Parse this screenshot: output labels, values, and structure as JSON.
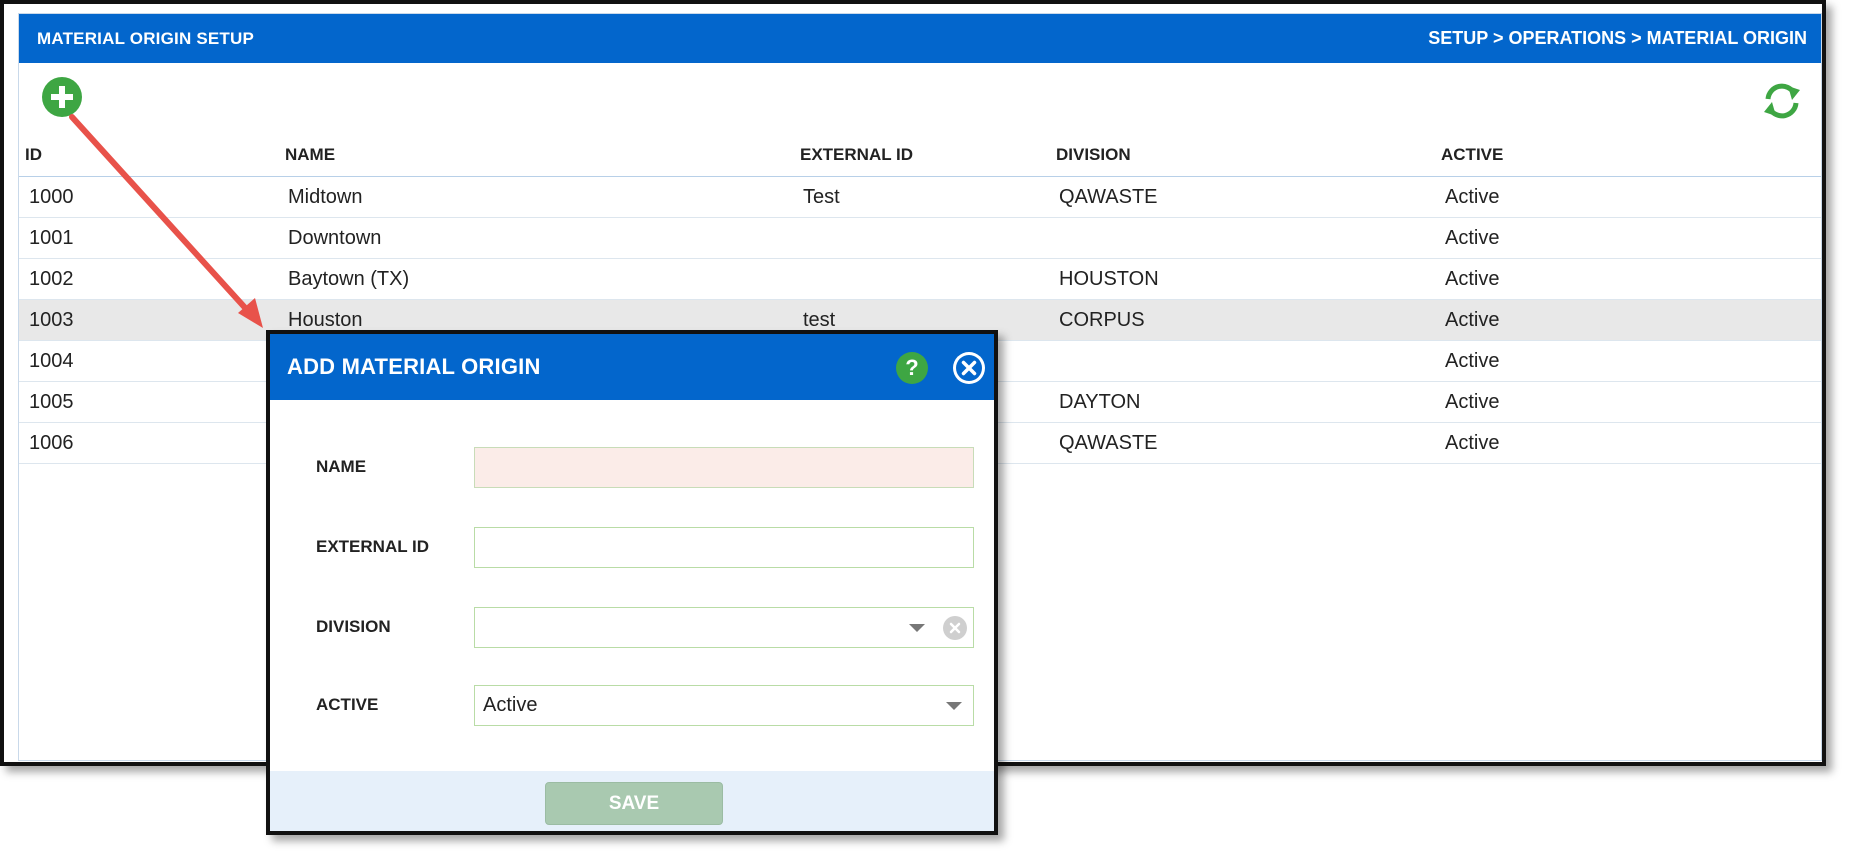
{
  "header": {
    "title": "MATERIAL ORIGIN SETUP",
    "breadcrumb": "SETUP > OPERATIONS > MATERIAL ORIGIN"
  },
  "toolbar": {
    "add_icon": "plus-circle-icon",
    "refresh_icon": "refresh-icon"
  },
  "table": {
    "columns": [
      "ID",
      "NAME",
      "EXTERNAL ID",
      "DIVISION",
      "ACTIVE"
    ],
    "rows": [
      {
        "id": "1000",
        "name": "Midtown",
        "external_id": "Test",
        "division": "QAWASTE",
        "active": "Active"
      },
      {
        "id": "1001",
        "name": "Downtown",
        "external_id": "",
        "division": "",
        "active": "Active"
      },
      {
        "id": "1002",
        "name": "Baytown (TX)",
        "external_id": "",
        "division": "HOUSTON",
        "active": "Active"
      },
      {
        "id": "1003",
        "name": "Houston",
        "external_id": "test",
        "division": "CORPUS",
        "active": "Active"
      },
      {
        "id": "1004",
        "name": "",
        "external_id": "",
        "division": "",
        "active": "Active"
      },
      {
        "id": "1005",
        "name": "",
        "external_id": "",
        "division": "DAYTON",
        "active": "Active"
      },
      {
        "id": "1006",
        "name": "",
        "external_id": "",
        "division": "QAWASTE",
        "active": "Active"
      }
    ]
  },
  "modal": {
    "title": "ADD MATERIAL ORIGIN",
    "help_label": "?",
    "fields": {
      "name_label": "NAME",
      "name_value": "",
      "external_id_label": "EXTERNAL ID",
      "external_id_value": "",
      "division_label": "DIVISION",
      "division_value": "",
      "active_label": "ACTIVE",
      "active_value": "Active"
    },
    "save_label": "SAVE"
  },
  "colors": {
    "header_blue": "#0366cc",
    "add_green": "#3ea643",
    "arrow_red": "#e8524a",
    "save_disabled": "#a9c9b0",
    "error_field": "#fbece8"
  }
}
